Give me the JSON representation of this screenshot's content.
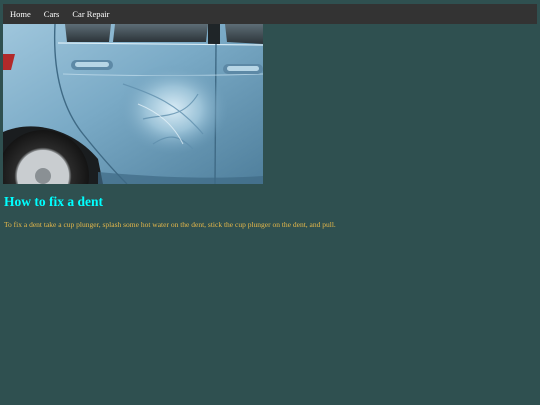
{
  "nav": {
    "items": [
      {
        "label": "Home"
      },
      {
        "label": "Cars"
      },
      {
        "label": "Car Repair"
      }
    ]
  },
  "hero_image": {
    "subject": "dented-blue-car-door-photo"
  },
  "article": {
    "title": "How to fix a dent",
    "text": "To fix a dent take a cup plunger, splash some hot water on the dent, stick the cup plunger on the dent, and pull."
  },
  "colors": {
    "background": "#2f5050",
    "navbar": "#333333",
    "nav_text": "#ffffff",
    "title": "#00ffff",
    "body_text": "#e6b84a"
  }
}
